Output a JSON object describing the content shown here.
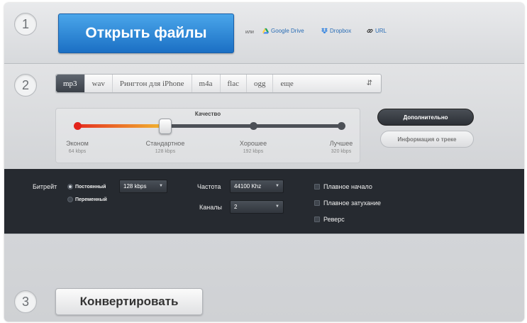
{
  "steps": {
    "one": "1",
    "two": "2",
    "three": "3"
  },
  "open": {
    "button_label": "Открыть файлы",
    "or_text": "или",
    "sources": [
      {
        "label": "Google Drive",
        "icon": "google-drive-icon"
      },
      {
        "label": "Dropbox",
        "icon": "dropbox-icon"
      },
      {
        "label": "URL",
        "icon": "link-icon"
      }
    ]
  },
  "formats": {
    "tabs": [
      "mp3",
      "wav",
      "Рингтон для iPhone",
      "m4a",
      "flac",
      "ogg"
    ],
    "selected": "mp3",
    "more": {
      "label": "еще",
      "icon": "up-down-arrows-icon"
    }
  },
  "quality": {
    "title": "Качество",
    "levels": [
      {
        "label": "Эконом",
        "bitrate": "64 kbps"
      },
      {
        "label": "Стандартное",
        "bitrate": "128 kbps"
      },
      {
        "label": "Хорошее",
        "bitrate": "192 kbps"
      },
      {
        "label": "Лучшее",
        "bitrate": "320 kbps"
      }
    ],
    "selected_index": 1,
    "colors": {
      "low": "#e53020",
      "mid": "#f2b830",
      "track": "#4c5056"
    }
  },
  "buttons": {
    "advanced": "Дополнительно",
    "track_info": "Информация о треке",
    "convert": "Конвертировать"
  },
  "advanced": {
    "bitrate_label": "Битрейт",
    "constant_label": "Постоянный",
    "variable_label": "Переменный",
    "bitrate_mode": "constant",
    "bitrate_value": "128 kbps",
    "frequency_label": "Частота",
    "frequency_value": "44100 Khz",
    "channels_label": "Каналы",
    "channels_value": "2",
    "fade_in": "Плавное начало",
    "fade_out": "Плавное затухание",
    "reverse": "Реверс"
  },
  "colors": {
    "accent_blue": "#1b6fc4",
    "dark_panel": "#262a30",
    "link": "#2a6db5"
  }
}
